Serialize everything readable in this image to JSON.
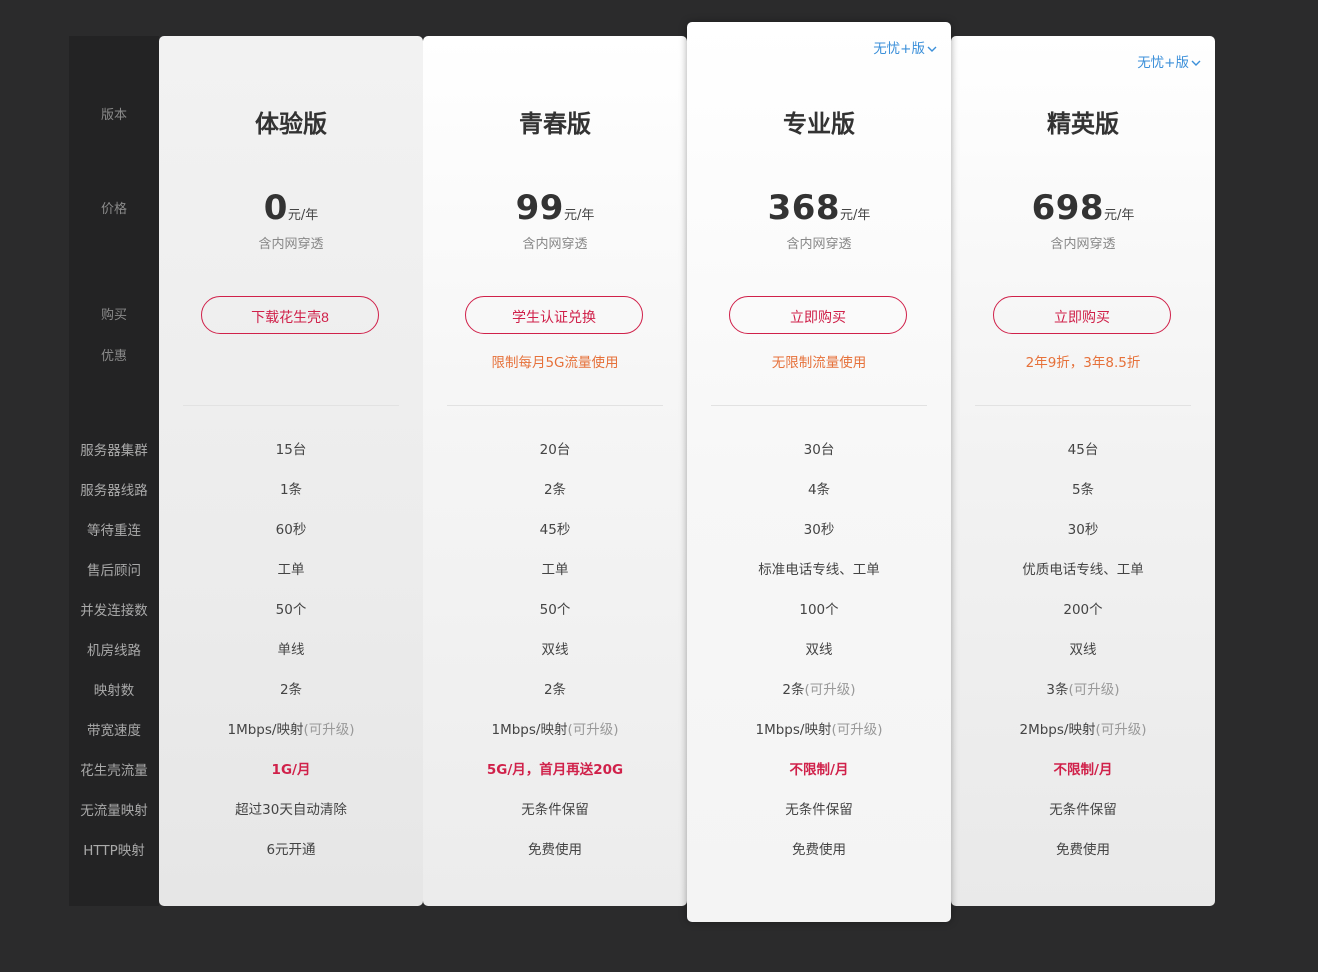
{
  "labels": {
    "version": "版本",
    "price": "价格",
    "buy": "购买",
    "promo": "优惠"
  },
  "feature_labels": [
    "服务器集群",
    "服务器线路",
    "等待重连",
    "售后顾问",
    "并发连接数",
    "机房线路",
    "映射数",
    "带宽速度",
    "花生壳流量",
    "无流量映射",
    "HTTP映射"
  ],
  "colors": {
    "accent": "#d0214a",
    "promo": "#e6713a",
    "link": "#3b8fd9"
  },
  "plans": [
    {
      "name": "体验版",
      "price": "0",
      "price_unit": "元/年",
      "price_note": "含内网穿透",
      "button": "下载花生壳8",
      "promo": "",
      "variant": "",
      "features": [
        {
          "main": "15台",
          "muted": ""
        },
        {
          "main": "1条",
          "muted": ""
        },
        {
          "main": "60秒",
          "muted": ""
        },
        {
          "main": "工单",
          "muted": ""
        },
        {
          "main": "50个",
          "muted": ""
        },
        {
          "main": "单线",
          "muted": ""
        },
        {
          "main": "2条",
          "muted": ""
        },
        {
          "main": "1Mbps/映射",
          "muted": "(可升级)"
        },
        {
          "main": "1G/月",
          "muted": ""
        },
        {
          "main": "超过30天自动清除",
          "muted": ""
        },
        {
          "main": "6元开通",
          "muted": ""
        }
      ]
    },
    {
      "name": "青春版",
      "price": "99",
      "price_unit": "元/年",
      "price_note": "含内网穿透",
      "button": "学生认证兑换",
      "promo": "限制每月5G流量使用",
      "variant": "",
      "features": [
        {
          "main": "20台",
          "muted": ""
        },
        {
          "main": "2条",
          "muted": ""
        },
        {
          "main": "45秒",
          "muted": ""
        },
        {
          "main": "工单",
          "muted": ""
        },
        {
          "main": "50个",
          "muted": ""
        },
        {
          "main": "双线",
          "muted": ""
        },
        {
          "main": "2条",
          "muted": ""
        },
        {
          "main": "1Mbps/映射",
          "muted": "(可升级)"
        },
        {
          "main": "5G/月，首月再送20G",
          "muted": ""
        },
        {
          "main": "无条件保留",
          "muted": ""
        },
        {
          "main": "免费使用",
          "muted": ""
        }
      ]
    },
    {
      "name": "专业版",
      "price": "368",
      "price_unit": "元/年",
      "price_note": "含内网穿透",
      "button": "立即购买",
      "promo": "无限制流量使用",
      "variant": "无忧+版",
      "features": [
        {
          "main": "30台",
          "muted": ""
        },
        {
          "main": "4条",
          "muted": ""
        },
        {
          "main": "30秒",
          "muted": ""
        },
        {
          "main": "标准电话专线、工单",
          "muted": ""
        },
        {
          "main": "100个",
          "muted": ""
        },
        {
          "main": "双线",
          "muted": ""
        },
        {
          "main": "2条",
          "muted": "(可升级)"
        },
        {
          "main": "1Mbps/映射",
          "muted": "(可升级)"
        },
        {
          "main": "不限制/月",
          "muted": ""
        },
        {
          "main": "无条件保留",
          "muted": ""
        },
        {
          "main": "免费使用",
          "muted": ""
        }
      ]
    },
    {
      "name": "精英版",
      "price": "698",
      "price_unit": "元/年",
      "price_note": "含内网穿透",
      "button": "立即购买",
      "promo": "2年9折，3年8.5折",
      "variant": "无忧+版",
      "features": [
        {
          "main": "45台",
          "muted": ""
        },
        {
          "main": "5条",
          "muted": ""
        },
        {
          "main": "30秒",
          "muted": ""
        },
        {
          "main": "优质电话专线、工单",
          "muted": ""
        },
        {
          "main": "200个",
          "muted": ""
        },
        {
          "main": "双线",
          "muted": ""
        },
        {
          "main": "3条",
          "muted": "(可升级)"
        },
        {
          "main": "2Mbps/映射",
          "muted": "(可升级)"
        },
        {
          "main": "不限制/月",
          "muted": ""
        },
        {
          "main": "无条件保留",
          "muted": ""
        },
        {
          "main": "免费使用",
          "muted": ""
        }
      ]
    }
  ]
}
